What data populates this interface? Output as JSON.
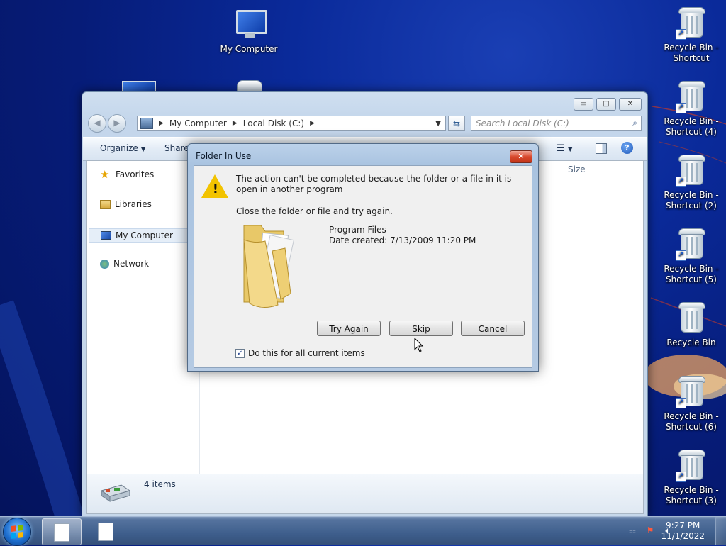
{
  "desktop": {
    "icons": [
      {
        "label": "My Computer"
      },
      {
        "label": "Recycle Bin - Shortcut"
      },
      {
        "label": "Recycle Bin - Shortcut (4)"
      },
      {
        "label": "Recycle Bin - Shortcut (2)"
      },
      {
        "label": "Recycle Bin - Shortcut (5)"
      },
      {
        "label": "Recycle Bin"
      },
      {
        "label": "Recycle Bin - Shortcut (6)"
      },
      {
        "label": "Recycle Bin - Shortcut (3)"
      }
    ]
  },
  "explorer": {
    "controls": {
      "minimize": "▭",
      "maximize": "□",
      "close": "✕"
    },
    "back_icon": "◀",
    "forward_icon": "▶",
    "breadcrumb": [
      "My Computer",
      "Local Disk (C:)"
    ],
    "search_placeholder": "Search Local Disk (C:)",
    "toolbar": {
      "organize": "Organize",
      "share": "Share"
    },
    "nav": {
      "favorites": "Favorites",
      "libraries": "Libraries",
      "my_computer": "My Computer",
      "network": "Network"
    },
    "column_size": "Size",
    "status": "4 items"
  },
  "dialog": {
    "title": "Folder In Use",
    "close_glyph": "✕",
    "message": "The action can't be completed because the folder or a file in it is open in another program",
    "instruction": "Close the folder or file and try again.",
    "file_name": "Program Files",
    "date_created": "Date created: 7/13/2009 11:20 PM",
    "buttons": {
      "try_again": "Try Again",
      "skip": "Skip",
      "cancel": "Cancel"
    },
    "checkbox_label": "Do this for all current items",
    "checkbox_checked": true
  },
  "taskbar": {
    "time": "9:27 PM",
    "date": "11/1/2022"
  },
  "colors": {
    "desktop_bg": "#0a2a9a",
    "warning": "#f2c300",
    "close_red": "#d8492e"
  }
}
